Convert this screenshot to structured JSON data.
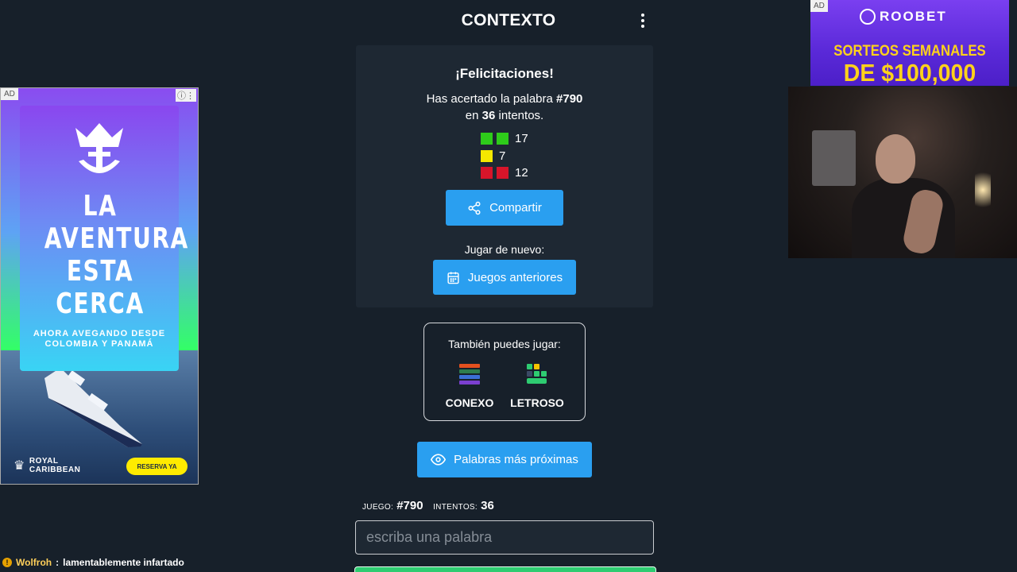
{
  "header": {
    "title": "CONTEXTO"
  },
  "result": {
    "congrats": "¡Felicitaciones!",
    "line1_prefix": "Has acertado la palabra",
    "word_number": "#790",
    "line2_prefix": "en",
    "attempts": "36",
    "line2_suffix": "intentos.",
    "stats": [
      {
        "color": "green",
        "squares": 2,
        "count": "17"
      },
      {
        "color": "yellow",
        "squares": 1,
        "count": "7"
      },
      {
        "color": "red",
        "squares": 2,
        "count": "12"
      }
    ],
    "share_label": "Compartir",
    "play_again_label": "Jugar de nuevo:",
    "previous_games_label": "Juegos anteriores"
  },
  "other_games": {
    "title": "También puedes jugar:",
    "games": [
      {
        "label": "CONEXO"
      },
      {
        "label": "LETROSO"
      }
    ]
  },
  "closest_words_label": "Palabras más próximas",
  "status": {
    "game_key": "JUEGO:",
    "game_value": "#790",
    "attempts_key": "INTENTOS:",
    "attempts_value": "36"
  },
  "guess_input": {
    "placeholder": "escriba una palabra",
    "value": ""
  },
  "ad_left": {
    "tag": "AD",
    "headline": "LA AVENTURA ESTA CERCA",
    "subline": "AHORA AVEGANDO DESDE COLOMBIA Y PANAMÁ",
    "brand_line1": "ROYAL",
    "brand_line2": "CARIBBEAN",
    "cta": "RESERVA YA"
  },
  "ad_right": {
    "tag": "AD",
    "brand": "ROOBET",
    "line1": "SORTEOS SEMANALES",
    "line2": "DE $100,000"
  },
  "chat": {
    "user": "Wolfroh",
    "separator": ":",
    "message": "lamentablemente infartado"
  },
  "colors": {
    "background": "#17202a",
    "card": "#1e2833",
    "accent_blue": "#2a9ff0",
    "square_green": "#2ecc1a",
    "square_yellow": "#f5e800",
    "square_red": "#d7152a"
  }
}
